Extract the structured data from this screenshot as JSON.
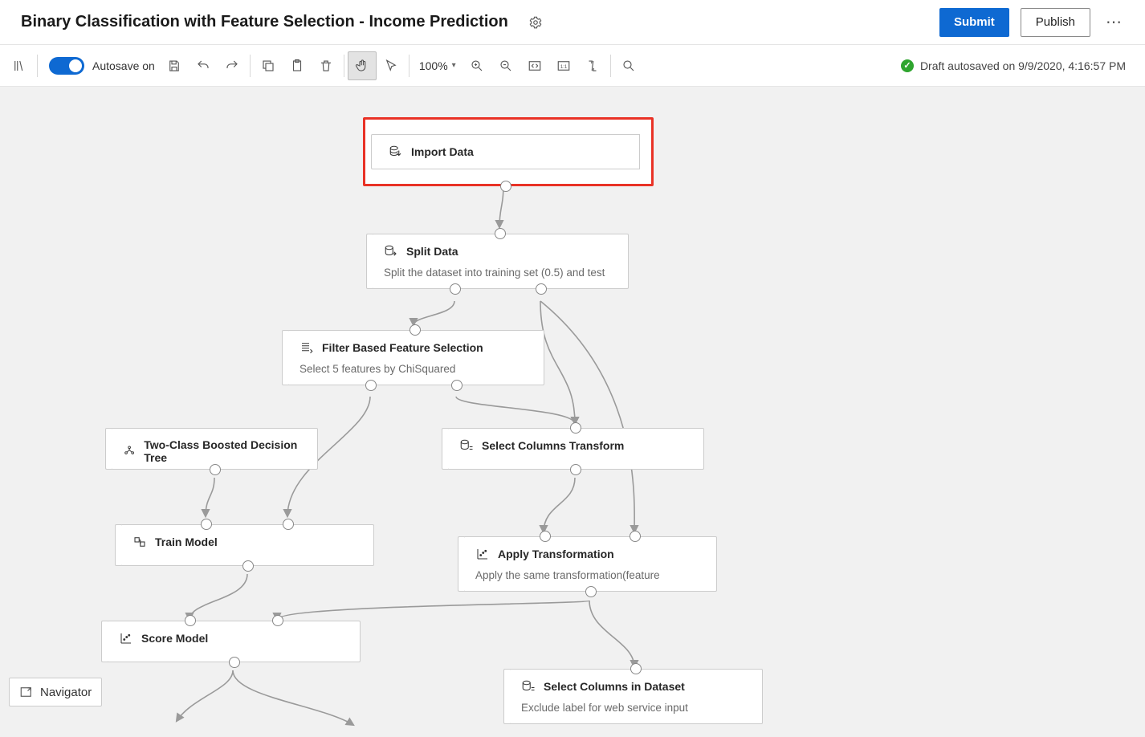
{
  "header": {
    "title": "Binary Classification with Feature Selection - Income Prediction",
    "submit_label": "Submit",
    "publish_label": "Publish"
  },
  "toolbar": {
    "autosave_label": "Autosave on",
    "zoom_level": "100%",
    "status_text": "Draft autosaved on 9/9/2020, 4:16:57 PM",
    "icons": {
      "library": "library-icon",
      "save": "save-icon",
      "undo": "undo-icon",
      "redo": "redo-icon",
      "copy": "copy-icon",
      "paste": "paste-icon",
      "delete": "delete-icon",
      "hand": "hand-icon",
      "pointer": "pointer-icon",
      "zoom_in": "zoom-in-icon",
      "zoom_out": "zoom-out-icon",
      "fit": "fit-icon",
      "actual": "actual-size-icon",
      "auto_layout": "auto-layout-icon",
      "search": "search-icon"
    }
  },
  "navigator": {
    "label": "Navigator"
  },
  "nodes": {
    "import_data": {
      "label": "Import Data"
    },
    "split_data": {
      "label": "Split Data",
      "desc": "Split the dataset into training set (0.5) and test"
    },
    "filter_feature": {
      "label": "Filter Based Feature Selection",
      "desc": "Select 5 features by ChiSquared"
    },
    "boosted_tree": {
      "label": "Two-Class Boosted Decision Tree"
    },
    "select_cols_trans": {
      "label": "Select Columns Transform"
    },
    "train_model": {
      "label": "Train Model"
    },
    "apply_trans": {
      "label": "Apply Transformation",
      "desc": "Apply the same transformation(feature"
    },
    "score_model": {
      "label": "Score Model"
    },
    "select_cols_dataset": {
      "label": "Select Columns in Dataset",
      "desc": "Exclude label for web service input"
    }
  }
}
